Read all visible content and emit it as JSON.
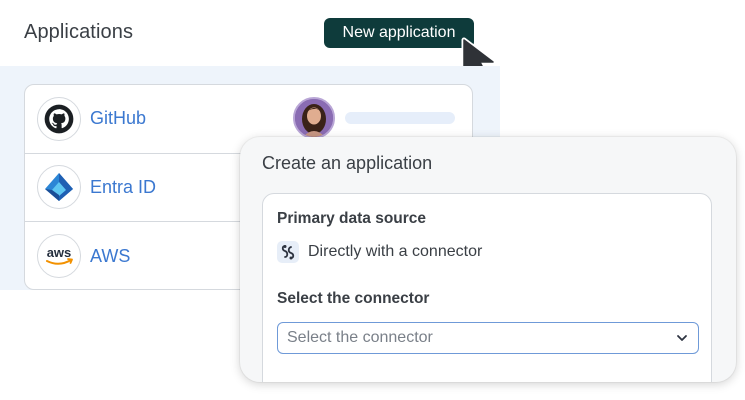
{
  "header": {
    "title": "Applications",
    "new_button_label": "New application"
  },
  "apps": [
    {
      "name": "GitHub",
      "icon": "github-icon"
    },
    {
      "name": "Entra ID",
      "icon": "entra-id-icon"
    },
    {
      "name": "AWS",
      "icon": "aws-icon",
      "logo_text": "aws"
    }
  ],
  "create_dialog": {
    "title": "Create an application",
    "primary_source_label": "Primary data source",
    "primary_source_value": "Directly with a connector",
    "connector_label": "Select the connector",
    "connector_placeholder": "Select the connector"
  },
  "colors": {
    "accent_dark": "#0e3b3b",
    "link_blue": "#3b78d0",
    "panel_bg": "#eef4fb"
  }
}
